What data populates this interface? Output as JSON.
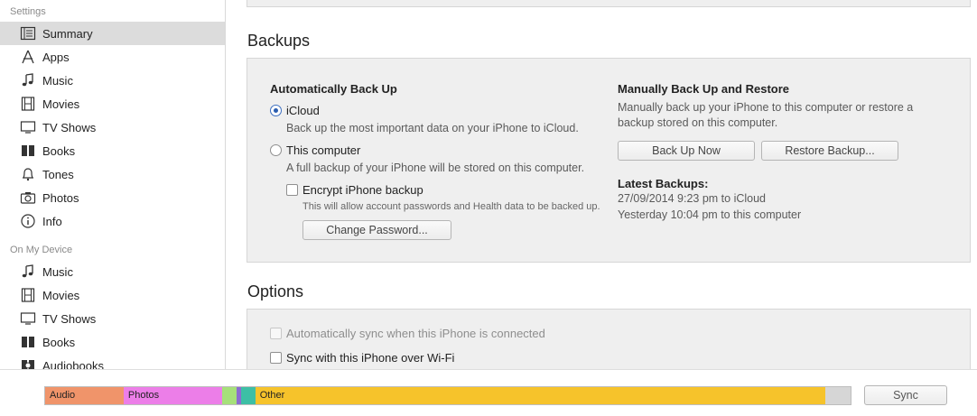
{
  "sidebar": {
    "settings_heading": "Settings",
    "settings_items": [
      {
        "label": "Summary",
        "icon": "summary-icon"
      },
      {
        "label": "Apps",
        "icon": "apps-icon"
      },
      {
        "label": "Music",
        "icon": "music-note-icon"
      },
      {
        "label": "Movies",
        "icon": "film-icon"
      },
      {
        "label": "TV Shows",
        "icon": "tv-icon"
      },
      {
        "label": "Books",
        "icon": "book-icon"
      },
      {
        "label": "Tones",
        "icon": "bell-icon"
      },
      {
        "label": "Photos",
        "icon": "camera-icon"
      },
      {
        "label": "Info",
        "icon": "info-icon"
      }
    ],
    "device_heading": "On My Device",
    "device_items": [
      {
        "label": "Music",
        "icon": "music-note-icon"
      },
      {
        "label": "Movies",
        "icon": "film-icon"
      },
      {
        "label": "TV Shows",
        "icon": "tv-icon"
      },
      {
        "label": "Books",
        "icon": "book-icon"
      },
      {
        "label": "Audiobooks",
        "icon": "audiobook-icon"
      }
    ]
  },
  "backups": {
    "title": "Backups",
    "auto_heading": "Automatically Back Up",
    "icloud_label": "iCloud",
    "icloud_desc": "Back up the most important data on your iPhone to iCloud.",
    "computer_label": "This computer",
    "computer_desc": "A full backup of your iPhone will be stored on this computer.",
    "encrypt_label": "Encrypt iPhone backup",
    "encrypt_desc": "This will allow account passwords and Health data to be backed up.",
    "change_password": "Change Password...",
    "manual_heading": "Manually Back Up and Restore",
    "manual_desc_1": "Manually back up your iPhone to this computer or restore a",
    "manual_desc_2": "backup stored on this computer.",
    "backup_now": "Back Up Now",
    "restore": "Restore Backup...",
    "latest_heading": "Latest Backups:",
    "latest_1": "27/09/2014 9:23 pm to iCloud",
    "latest_2": "Yesterday 10:04 pm to this computer"
  },
  "options": {
    "title": "Options",
    "auto_sync": "Automatically sync when this iPhone is connected",
    "wifi_sync": "Sync with this iPhone over Wi-Fi"
  },
  "capacity": {
    "segments": [
      {
        "label": "Audio",
        "color": "#f0946a",
        "fraction": 0.097
      },
      {
        "label": "Photos",
        "color": "#ec7ee8",
        "fraction": 0.122
      },
      {
        "label": "",
        "color": "#a6e07a",
        "fraction": 0.018
      },
      {
        "label": "",
        "color": "#8b6dd0",
        "fraction": 0.006
      },
      {
        "label": "",
        "color": "#3dbfa5",
        "fraction": 0.018
      },
      {
        "label": "Other",
        "color": "#f6c32b",
        "fraction": 0.708
      },
      {
        "label": "",
        "color": "#d6d6d6",
        "fraction": 0.031
      }
    ]
  },
  "sync_button": "Sync"
}
